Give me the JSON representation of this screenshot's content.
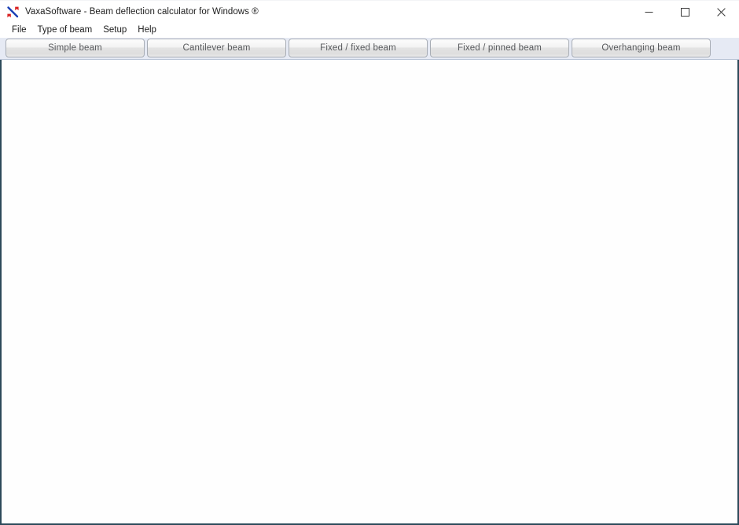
{
  "window": {
    "title": "VaxaSoftware - Beam deflection calculator for Windows ®",
    "icon": "app-logo-icon",
    "border_color": "#2d4a5a",
    "titlebar_bg": "#ffffff",
    "controls": {
      "minimize_label": "–",
      "minimize_name": "minimize-icon",
      "maximize_label": "□",
      "maximize_name": "maximize-icon",
      "close_label": "✕",
      "close_name": "close-icon"
    }
  },
  "menubar": {
    "items": [
      {
        "label": "File",
        "name": "menu-file"
      },
      {
        "label": "Type of beam",
        "name": "menu-type-of-beam"
      },
      {
        "label": "Setup",
        "name": "menu-setup"
      },
      {
        "label": "Help",
        "name": "menu-help"
      }
    ]
  },
  "tabstrip": {
    "background": "#e6eaf4",
    "tabs": [
      {
        "label": "Simple beam",
        "name": "tab-simple-beam"
      },
      {
        "label": "Cantilever beam",
        "name": "tab-cantilever-beam"
      },
      {
        "label": "Fixed / fixed beam",
        "name": "tab-fixed-fixed-beam"
      },
      {
        "label": "Fixed / pinned beam",
        "name": "tab-fixed-pinned-beam"
      },
      {
        "label": "Overhanging beam",
        "name": "tab-overhanging-beam"
      }
    ]
  },
  "content": {
    "text": "",
    "background": "#ffffff"
  }
}
